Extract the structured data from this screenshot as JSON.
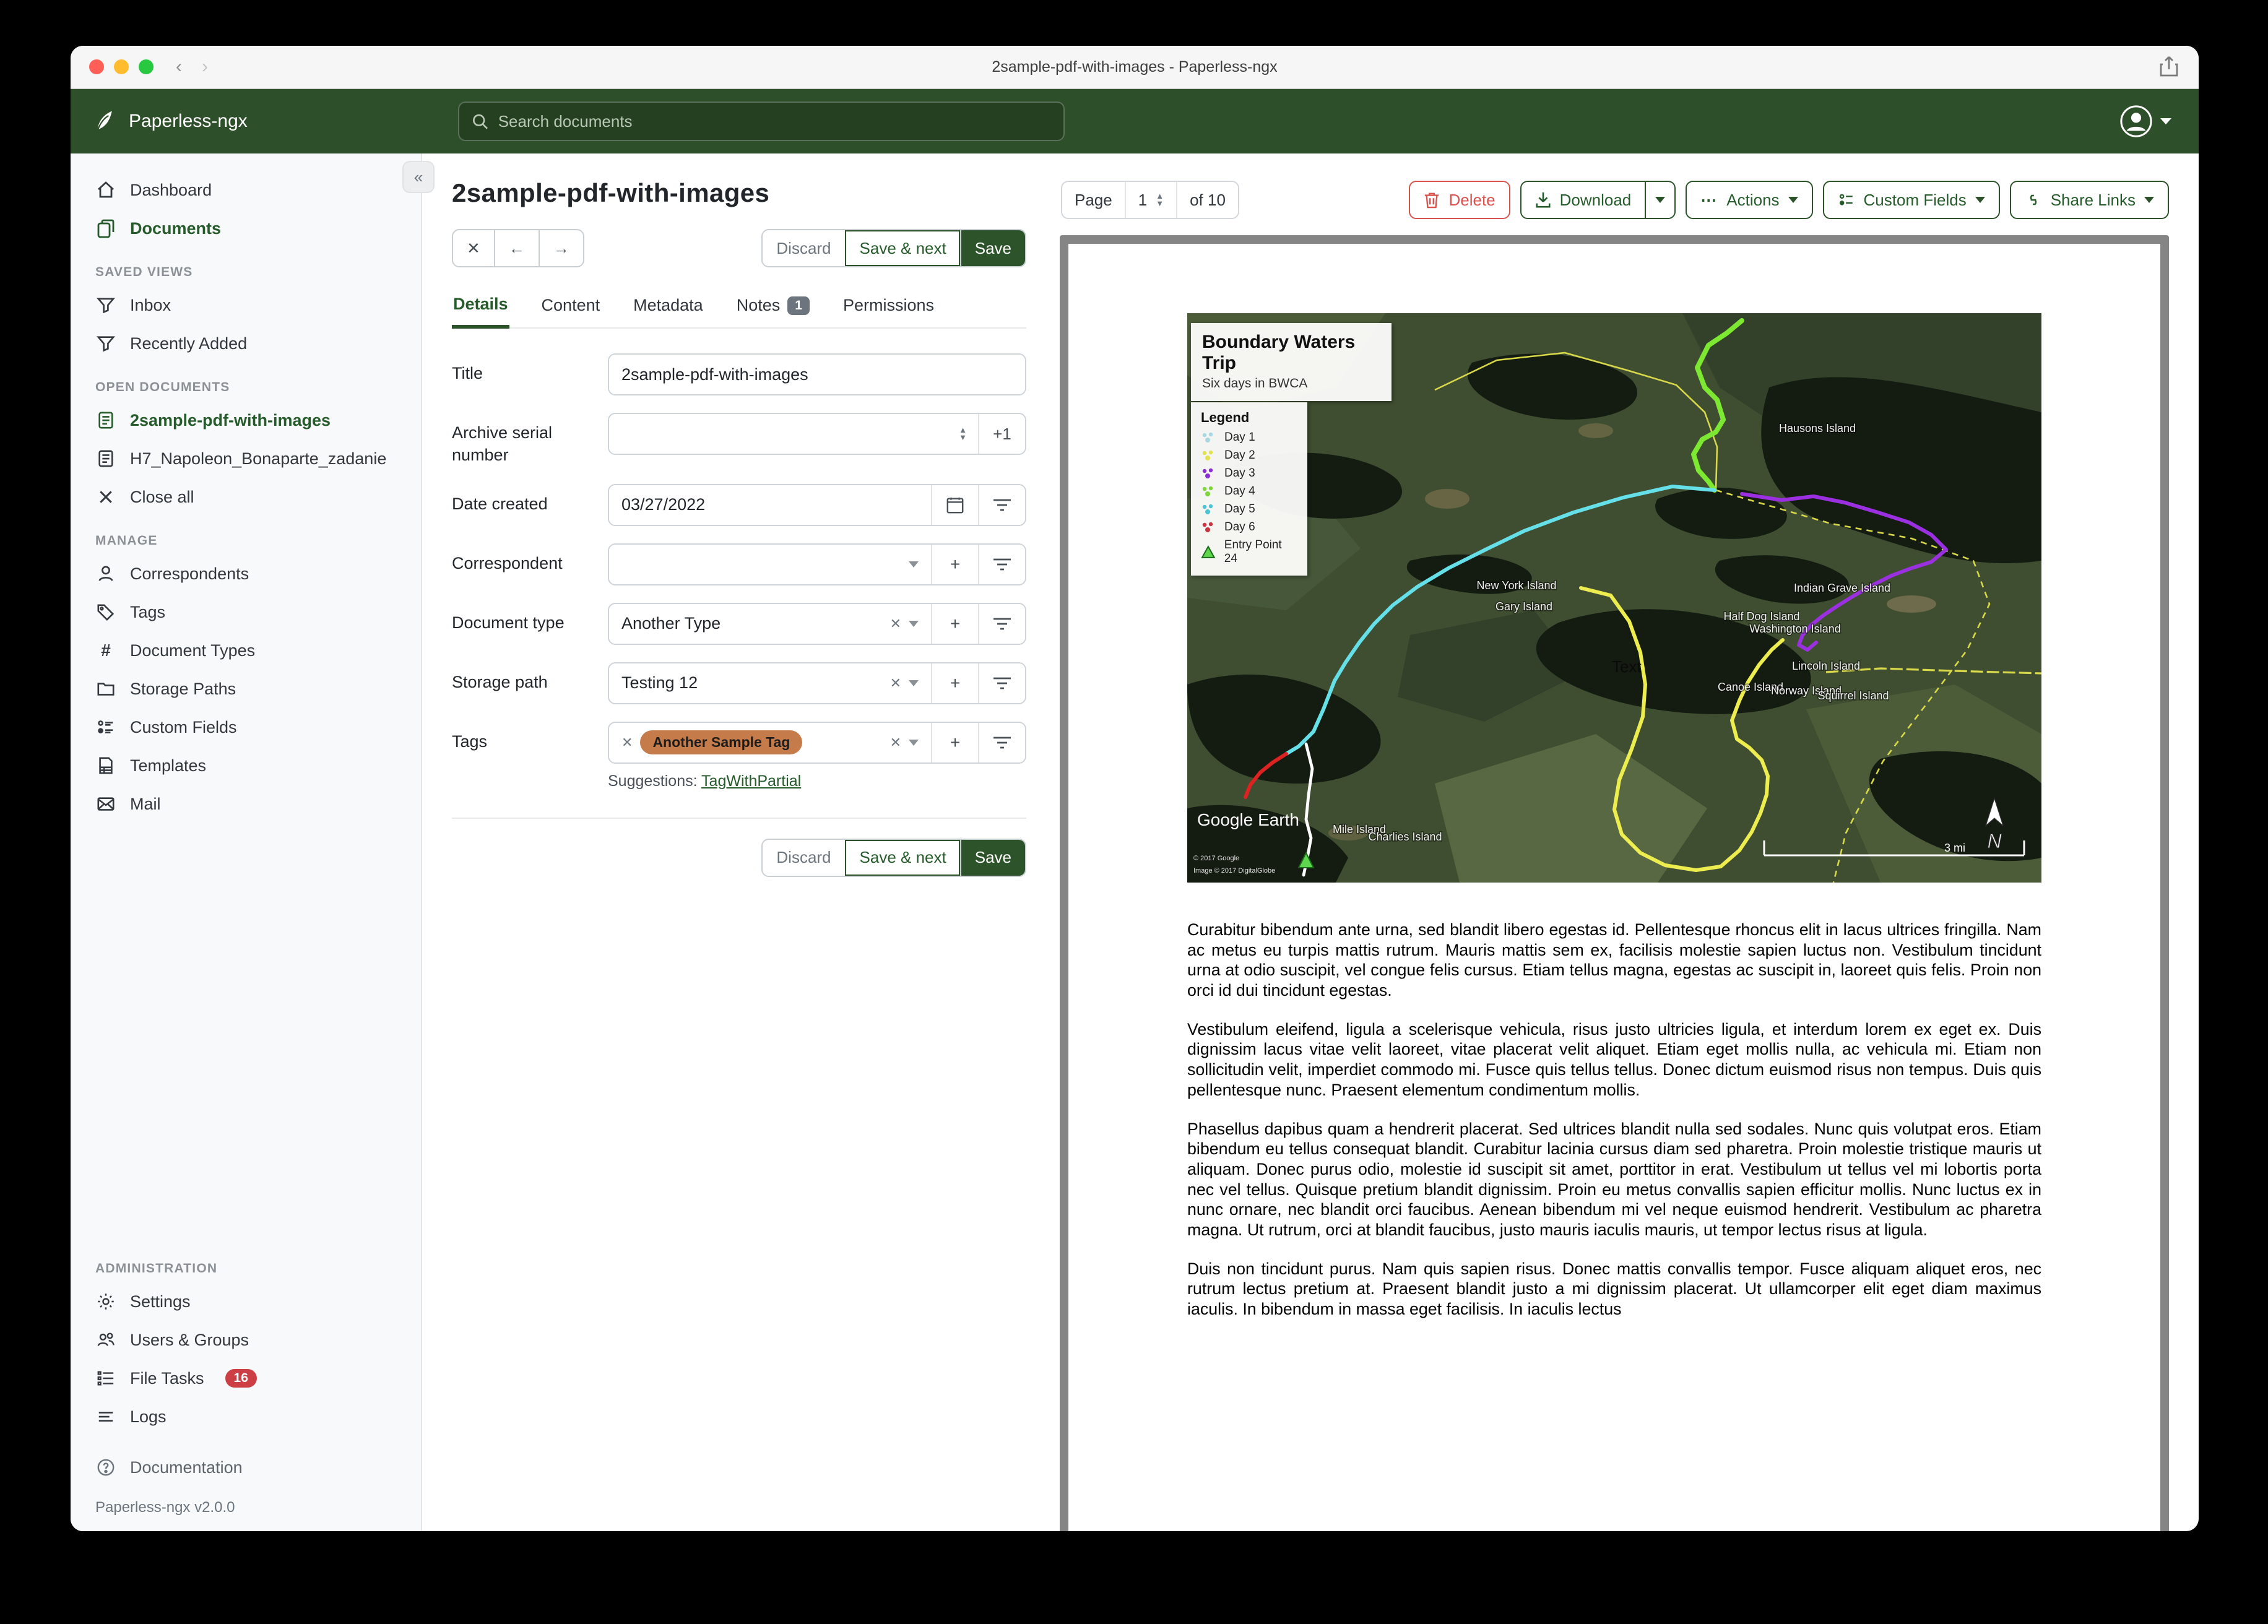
{
  "window": {
    "title": "2sample-pdf-with-images - Paperless-ngx"
  },
  "header": {
    "app_name": "Paperless-ngx",
    "search_placeholder": "Search documents"
  },
  "sidebar": {
    "items_top": [
      {
        "label": "Dashboard"
      },
      {
        "label": "Documents"
      }
    ],
    "saved_views_header": "SAVED VIEWS",
    "saved_views": [
      {
        "label": "Inbox"
      },
      {
        "label": "Recently Added"
      }
    ],
    "open_documents_header": "OPEN DOCUMENTS",
    "open_documents": [
      {
        "label": "2sample-pdf-with-images"
      },
      {
        "label": "H7_Napoleon_Bonaparte_zadanie"
      },
      {
        "label": "Close all"
      }
    ],
    "manage_header": "MANAGE",
    "manage": [
      {
        "label": "Correspondents"
      },
      {
        "label": "Tags"
      },
      {
        "label": "Document Types"
      },
      {
        "label": "Storage Paths"
      },
      {
        "label": "Custom Fields"
      },
      {
        "label": "Templates"
      },
      {
        "label": "Mail"
      }
    ],
    "admin_header": "ADMINISTRATION",
    "admin": [
      {
        "label": "Settings"
      },
      {
        "label": "Users & Groups"
      },
      {
        "label": "File Tasks",
        "badge": "16"
      },
      {
        "label": "Logs"
      }
    ],
    "documentation": "Documentation",
    "version": "Paperless-ngx v2.0.0"
  },
  "content": {
    "doc_title": "2sample-pdf-with-images",
    "discard": "Discard",
    "save_next": "Save & next",
    "save": "Save",
    "tabs": [
      {
        "label": "Details"
      },
      {
        "label": "Content"
      },
      {
        "label": "Metadata"
      },
      {
        "label": "Notes",
        "badge": "1"
      },
      {
        "label": "Permissions"
      }
    ],
    "form": {
      "title_label": "Title",
      "title_value": "2sample-pdf-with-images",
      "asn_label": "Archive serial number",
      "asn_plus": "+1",
      "date_label": "Date created",
      "date_value": "03/27/2022",
      "correspondent_label": "Correspondent",
      "doctype_label": "Document type",
      "doctype_value": "Another Type",
      "storage_label": "Storage path",
      "storage_value": "Testing 12",
      "tags_label": "Tags",
      "tag_chip": "Another Sample Tag",
      "suggestions_label": "Suggestions:",
      "suggestion_link": "TagWithPartial"
    }
  },
  "preview": {
    "page_label": "Page",
    "page_value": "1",
    "of_label": "of 10",
    "delete": "Delete",
    "download": "Download",
    "actions": "Actions",
    "custom_fields": "Custom Fields",
    "share_links": "Share Links",
    "map": {
      "title": "Boundary Waters Trip",
      "subtitle": "Six days in BWCA",
      "legend_title": "Legend",
      "legend": [
        {
          "label": "Day 1",
          "color": "#a9d8e2"
        },
        {
          "label": "Day 2",
          "color": "#e2e24e"
        },
        {
          "label": "Day 3",
          "color": "#8a2fd6"
        },
        {
          "label": "Day 4",
          "color": "#7fd63a"
        },
        {
          "label": "Day 5",
          "color": "#4cc4d4"
        },
        {
          "label": "Day 6",
          "color": "#cc3340"
        },
        {
          "label": "Entry Point 24",
          "color": "#5ed64e"
        }
      ],
      "islands": [
        {
          "name": "Hausons Island"
        },
        {
          "name": "New York Island"
        },
        {
          "name": "Gary Island"
        },
        {
          "name": "Indian Grave Island"
        },
        {
          "name": "Half Dog Island"
        },
        {
          "name": "Washington Island"
        },
        {
          "name": "Lincoln Island"
        },
        {
          "name": "Canoe Island"
        },
        {
          "name": "Norway Island"
        },
        {
          "name": "Squirrel Island"
        },
        {
          "name": "Mile Island"
        },
        {
          "name": "Charlies Island"
        }
      ],
      "text_label": "Text",
      "google_earth": "Google Earth",
      "copyright1": "© 2017 Google",
      "copyright2": "Image © 2017 DigitalGlobe",
      "scale_label": "3 mi",
      "compass": "N"
    },
    "paragraphs": [
      "Curabitur bibendum ante urna, sed blandit libero egestas id. Pellentesque rhoncus elit in lacus ultrices fringilla. Nam ac metus eu turpis mattis rutrum. Mauris mattis sem ex, facilisis molestie sapien luctus non. Vestibulum tincidunt urna at odio suscipit, vel congue felis cursus. Etiam tellus magna, egestas ac suscipit in, laoreet quis felis. Proin non orci id dui tincidunt egestas.",
      "Vestibulum eleifend, ligula a scelerisque vehicula, risus justo ultricies ligula, et interdum lorem ex eget ex. Duis dignissim lacus vitae velit laoreet, vitae placerat velit aliquet. Etiam eget mollis nulla, ac vehicula mi. Etiam non sollicitudin velit, imperdiet commodo mi. Fusce quis tellus tellus. Donec dictum euismod risus non tempus. Duis quis pellentesque nunc. Praesent elementum condimentum mollis.",
      "Phasellus dapibus quam a hendrerit placerat. Sed ultrices blandit nulla sed sodales. Nunc quis volutpat eros. Etiam bibendum eu tellus consequat blandit. Curabitur lacinia cursus diam sed pharetra. Proin molestie tristique mauris ut aliquam. Donec purus odio, molestie id suscipit sit amet, porttitor in erat. Vestibulum ut tellus vel mi lobortis porta nec vel tellus. Quisque pretium blandit dignissim. Proin eu metus convallis sapien efficitur mollis. Nunc luctus ex in nunc ornare, nec blandit orci faucibus. Aenean bibendum mi vel neque euismod hendrerit. Vestibulum ac pharetra magna. Ut rutrum, orci at blandit faucibus, justo mauris iaculis mauris, ut tempor lectus risus at ligula.",
      "Duis non tincidunt purus. Nam quis sapien risus. Donec mattis convallis tempor. Fusce aliquam aliquet eros, nec rutrum lectus pretium at. Praesent blandit justo a mi dignissim placerat. Ut ullamcorper elit eget diam maximus iaculis. In bibendum in massa eget facilisis. In iaculis lectus"
    ]
  }
}
